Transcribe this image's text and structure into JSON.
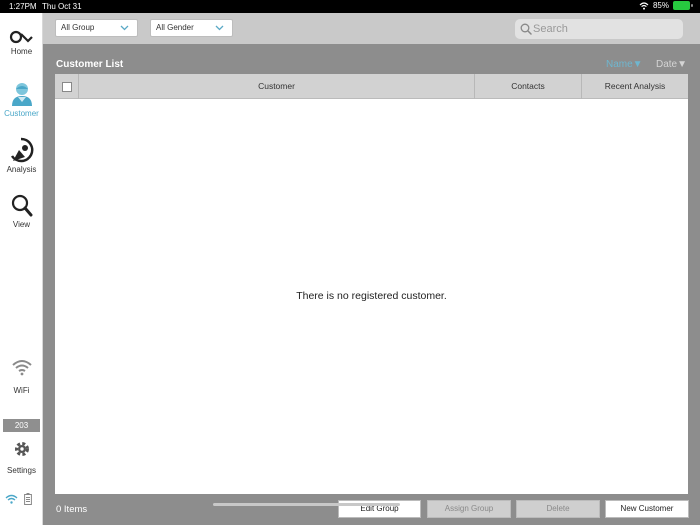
{
  "status_bar": {
    "time": "1:27PM",
    "date": "Thu Oct 31",
    "battery": "85%"
  },
  "sidebar": {
    "items": [
      {
        "label": "Home",
        "icon": "logo-icon"
      },
      {
        "label": "Customer",
        "icon": "customer-icon",
        "active": true
      },
      {
        "label": "Analysis",
        "icon": "analysis-icon"
      },
      {
        "label": "View",
        "icon": "magnifier-icon"
      },
      {
        "label": "WiFi",
        "icon": "wifi-icon"
      },
      {
        "label": "Settings",
        "icon": "gear-icon"
      }
    ],
    "badge": "203"
  },
  "filters": {
    "group": "All Group",
    "gender": "All Gender"
  },
  "search": {
    "placeholder": "Search"
  },
  "list": {
    "title": "Customer List",
    "sort_name": "Name▼",
    "sort_date": "Date▼",
    "columns": [
      "Customer",
      "Contacts",
      "Recent Analysis"
    ],
    "empty_message": "There is no registered customer.",
    "count": "0 Items"
  },
  "actions": {
    "edit_group": "Edit Group",
    "assign_group": "Assign Group",
    "delete": "Delete",
    "new_customer": "New Customer"
  },
  "colors": {
    "accent": "#4aa7c8",
    "panel": "#8d8d8d",
    "topbar": "#c9c9c9"
  }
}
